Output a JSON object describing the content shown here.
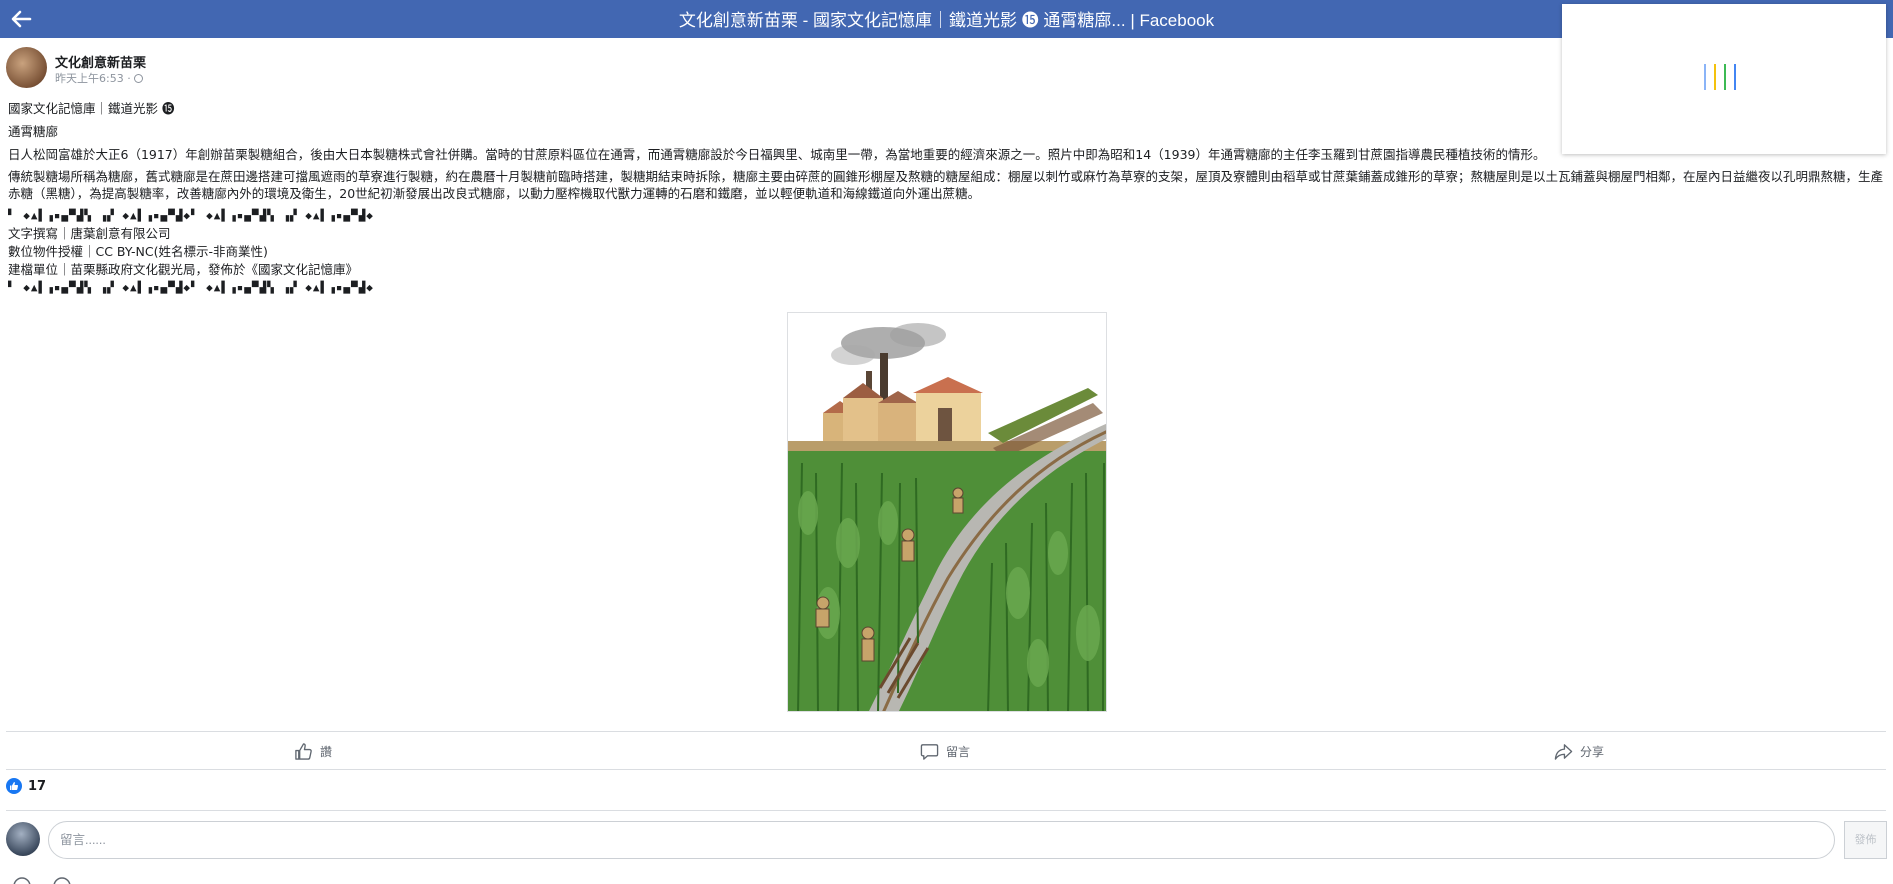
{
  "header": {
    "title": "文化創意新苗栗 - 國家文化記憶庫｜鐵道光影 ⓯ 通霄糖廍... | Facebook",
    "bg_color": "#4267b2"
  },
  "post": {
    "author": "文化創意新苗栗",
    "time": "昨天上午6:53 ·",
    "lines": {
      "l1": "國家文化記憶庫｜鐵道光影 ⓯",
      "l2": "通霄糖廍",
      "l3": "日人松岡富雄於大正6（1917）年創辦苗栗製糖組合，後由大日本製糖株式會社併購。當時的甘蔗原料區位在通霄，而通霄糖廍設於今日福興里、城南里一帶，為當地重要的經濟來源之一。照片中即為昭和14（1939）年通霄糖廍的主任李玉羅到甘蔗園指導農民種植技術的情形。",
      "l4": "傳統製糖場所稱為糖廍，舊式糖廍是在蔗田邊搭建可擋風遮雨的草寮進行製糖，約在農曆十月製糖前臨時搭建，製糖期結束時拆除，糖廍主要由碎蔗的圓錐形棚屋及熬糖的糖屋組成：棚屋以刺竹或麻竹為草寮的支架，屋頂及寮體則由稻草或甘蔗葉鋪蓋成錐形的草寮；熬糖屋則是以土瓦鋪蓋與棚屋門相鄰，在屋內日益繼夜以孔明鼎熬糖，生產赤糖（黑糖），為提高製糖率，改善糖廍內外的環境及衛生，20世紀初漸發展出改良式糖廍，以動力壓榨機取代獸力運轉的石磨和鐵磨，並以輕便軌道和海線鐵道向外運出蔗糖。",
      "l5": "▘ ◆▲▌▗▪▄▀▟▚ ▗▞ ◆▲▌▗▪▄▀▟◆▘ ◆▲▌▗▪▄▀▟▚ ▗▞ ◆▲▌▗▪▄▀▟◆",
      "l6": "文字撰寫｜唐葉創意有限公司",
      "l7": "數位物件授權｜CC BY-NC(姓名標示-非商業性)",
      "l8": "建檔單位｜苗栗縣政府文化觀光局，發佈於《國家文化記憶庫》",
      "l9": "▘ ◆▲▌▗▪▄▀▟▚ ▗▞ ◆▲▌▗▪▄▀▟◆▘ ◆▲▌▗▪▄▀▟▚ ▗▞ ◆▲▌▗▪▄▀▟◆"
    }
  },
  "actions": {
    "like": "讚",
    "comment": "留言",
    "share": "分享"
  },
  "reactions": {
    "count": "17",
    "like_color": "#1877f2"
  },
  "comment_box": {
    "placeholder": "留言......",
    "send": "發佈"
  },
  "icons": {
    "back": "arrow-left-icon",
    "like": "thumbs-up-icon",
    "comment": "comment-bubble-icon",
    "share": "share-arrow-icon"
  }
}
